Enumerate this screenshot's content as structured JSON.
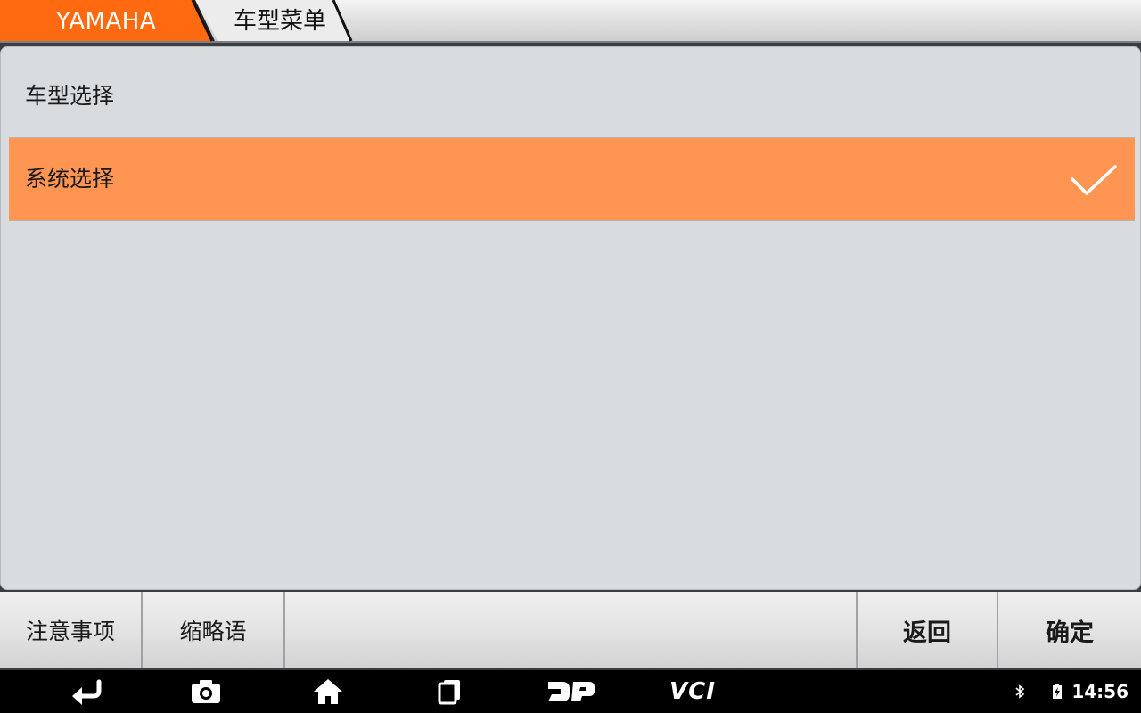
{
  "breadcrumb": {
    "brand": "YAMAHA",
    "menu": "车型菜单"
  },
  "list": {
    "items": [
      {
        "label": "车型选择",
        "selected": false
      },
      {
        "label": "系统选择",
        "selected": true
      }
    ]
  },
  "buttons": {
    "notes": "注意事项",
    "abbreviations": "缩略语",
    "back": "返回",
    "confirm": "确定"
  },
  "navbar": {
    "icons": [
      "back-arrow-icon",
      "camera-icon",
      "home-icon",
      "recent-apps-icon",
      "dp-logo-icon",
      "vci-icon"
    ],
    "vci_label": "VCI",
    "status_icons": [
      "bluetooth-icon",
      "wifi-icon",
      "battery-icon"
    ],
    "clock": "14:56"
  },
  "colors": {
    "brand_orange": "#ff6a10",
    "selected_row": "#ff9553",
    "panel_bg": "#d8dcdf"
  }
}
